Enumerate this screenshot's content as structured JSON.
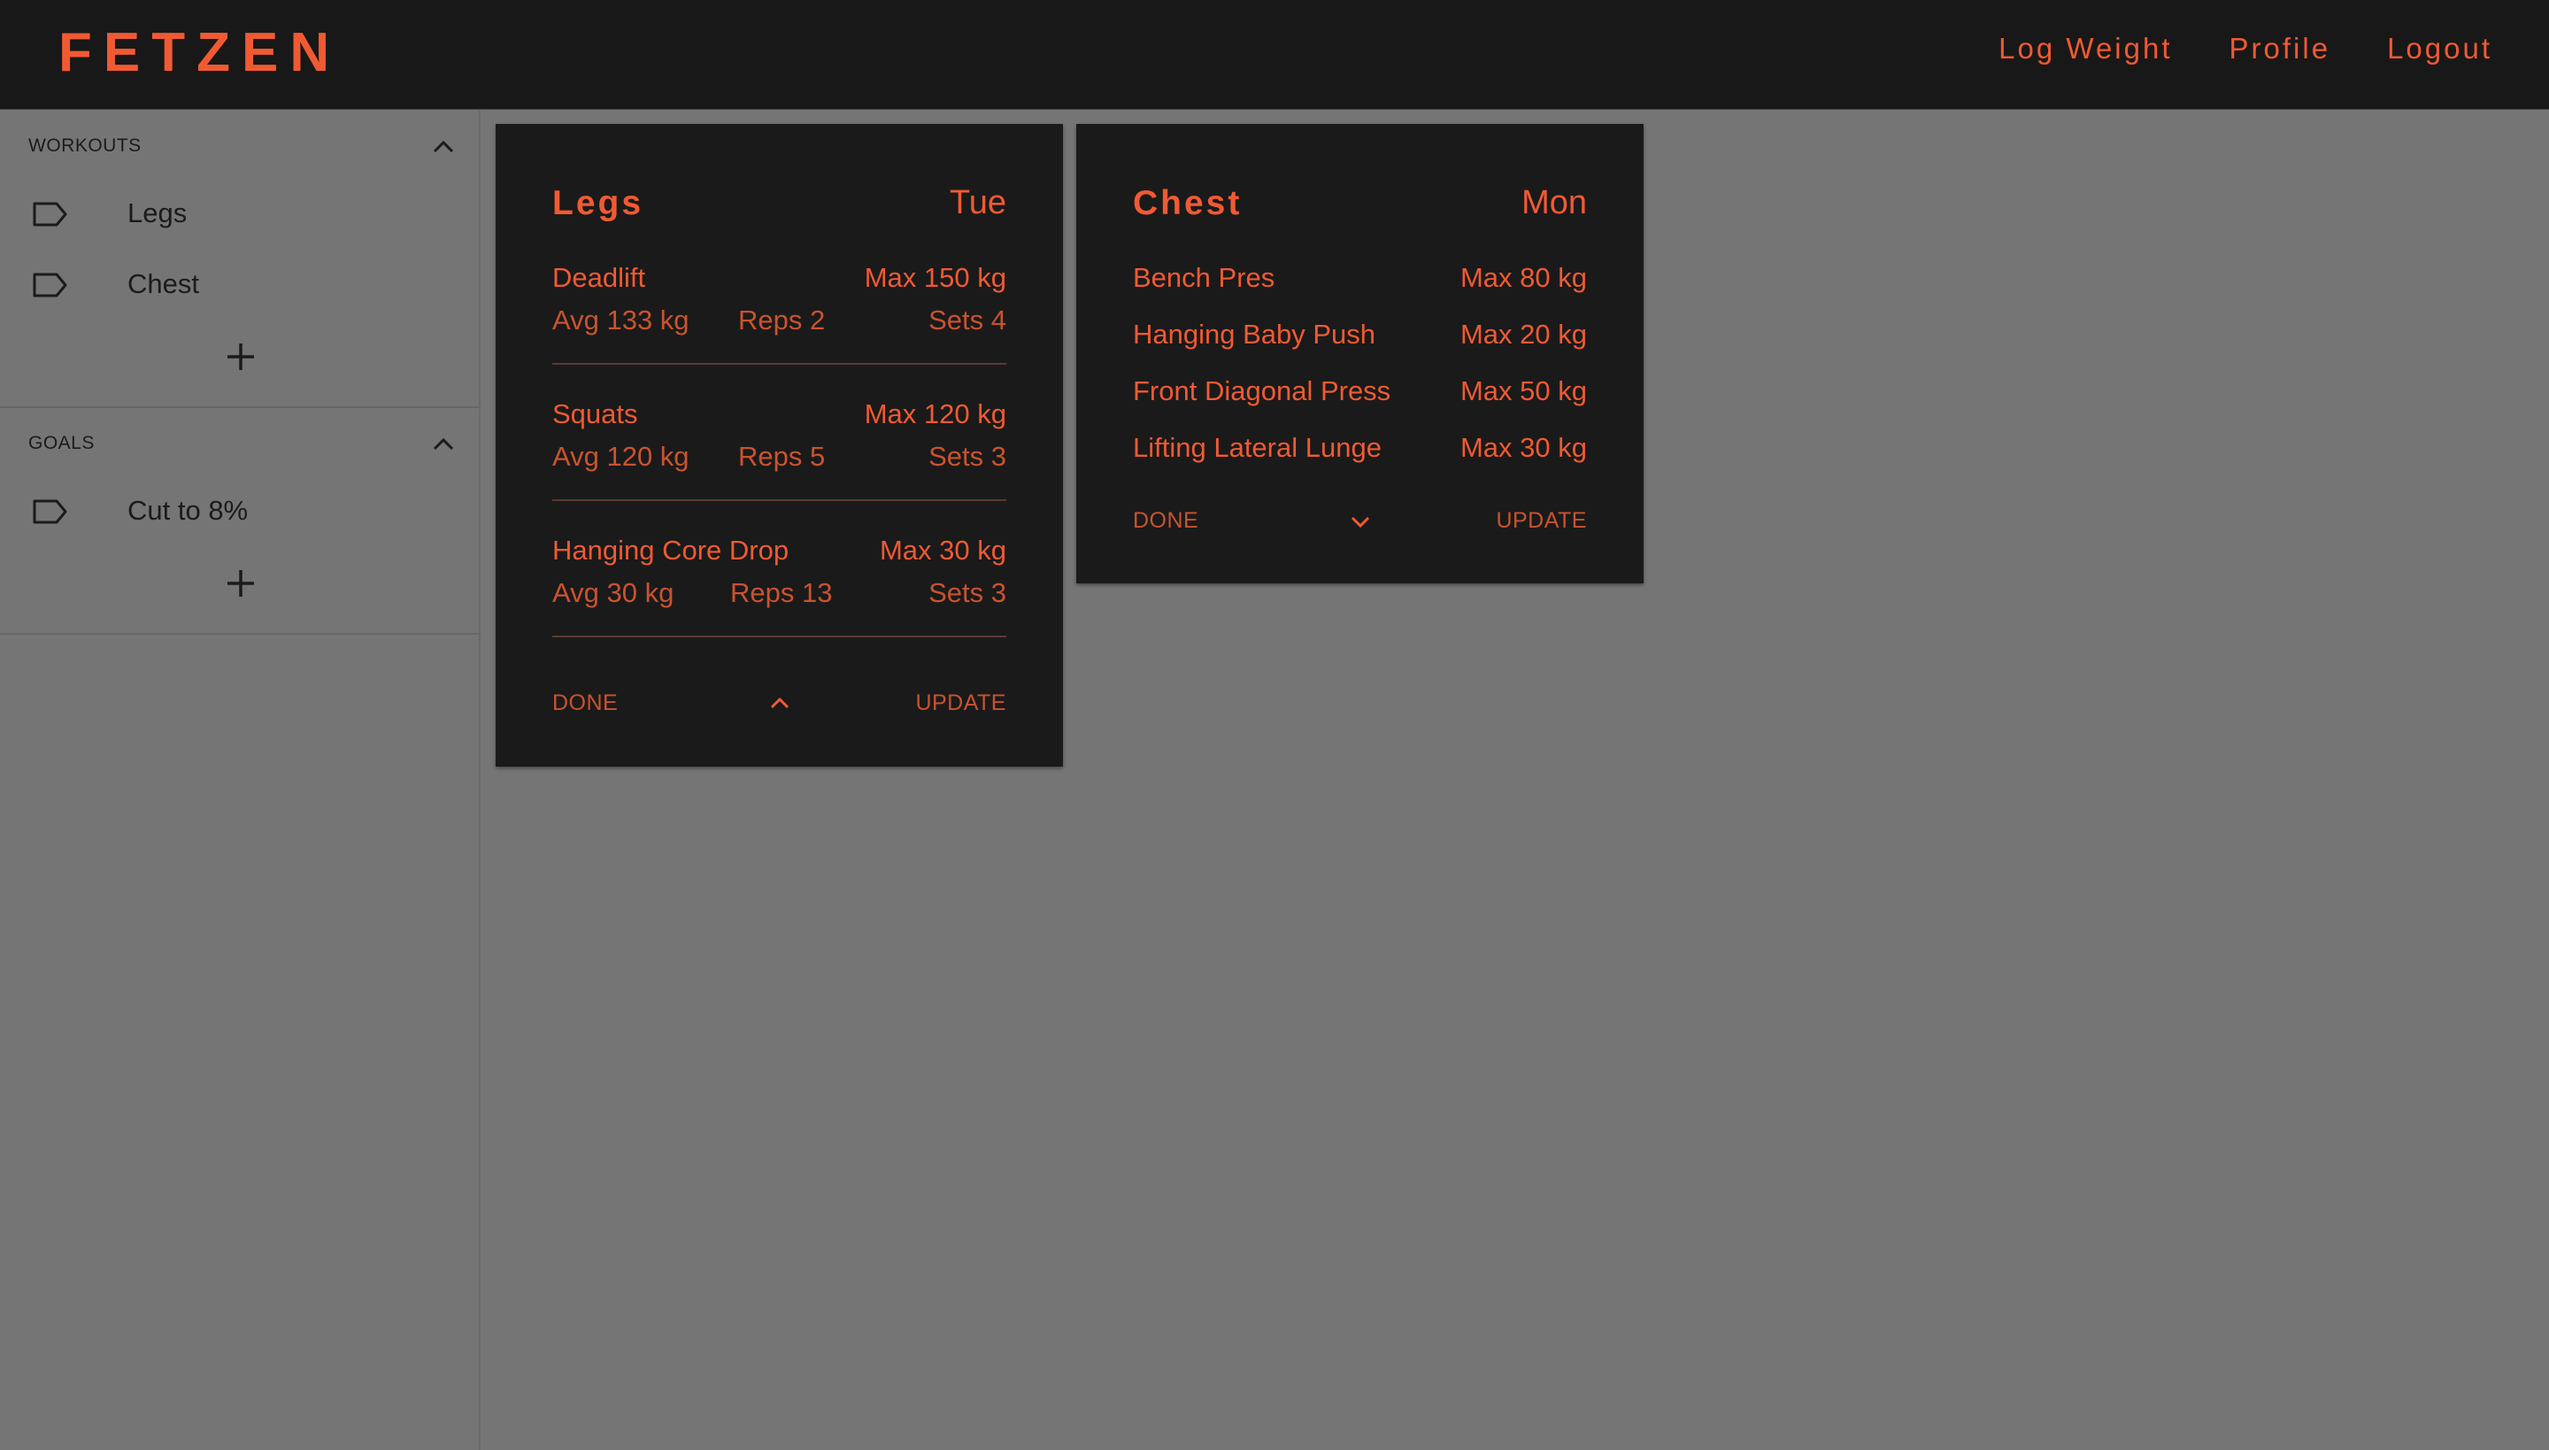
{
  "app": {
    "brand": "FETZEN"
  },
  "nav": {
    "log_weight": "Log Weight",
    "profile": "Profile",
    "logout": "Logout"
  },
  "sidebar": {
    "workouts": {
      "title": "WORKOUTS",
      "items": [
        {
          "label": "Legs"
        },
        {
          "label": "Chest"
        }
      ]
    },
    "goals": {
      "title": "GOALS",
      "items": [
        {
          "label": "Cut to 8%"
        }
      ]
    }
  },
  "cards": {
    "legs": {
      "title": "Legs",
      "day": "Tue",
      "exercises": [
        {
          "name": "Deadlift",
          "max": "Max 150 kg",
          "avg": "Avg 133 kg",
          "reps": "Reps 2",
          "sets": "Sets 4"
        },
        {
          "name": "Squats",
          "max": "Max 120 kg",
          "avg": "Avg 120 kg",
          "reps": "Reps 5",
          "sets": "Sets 3"
        },
        {
          "name": "Hanging Core Drop",
          "max": "Max 30 kg",
          "avg": "Avg 30 kg",
          "reps": "Reps 13",
          "sets": "Sets 3"
        }
      ],
      "done": "DONE",
      "update": "UPDATE"
    },
    "chest": {
      "title": "Chest",
      "day": "Mon",
      "exercises": [
        {
          "name": "Bench Pres",
          "max": "Max 80 kg"
        },
        {
          "name": "Hanging Baby Push",
          "max": "Max 20 kg"
        },
        {
          "name": "Front Diagonal Press",
          "max": "Max 50 kg"
        },
        {
          "name": "Lifting Lateral Lunge",
          "max": "Max 30 kg"
        }
      ],
      "done": "DONE",
      "update": "UPDATE"
    }
  },
  "colors": {
    "accent": "#f05a33",
    "accent_dim": "#c9532f",
    "card_bg": "#1a1a1a",
    "topbar_bg": "#181818",
    "page_bg": "#757575"
  },
  "icons": {
    "tag": "tag-icon",
    "add": "plus-icon",
    "collapse": "chevron-up-icon",
    "expand": "chevron-down-icon"
  }
}
